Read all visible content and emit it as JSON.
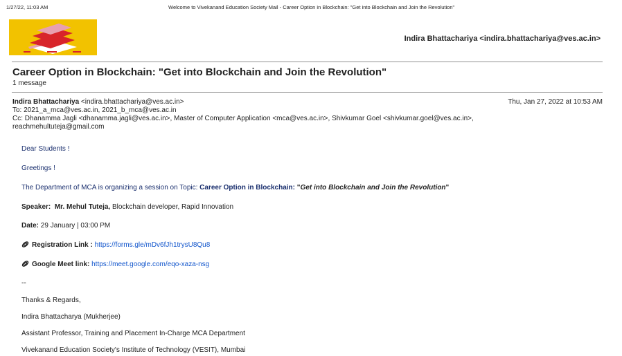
{
  "print_header": {
    "datetime": "1/27/22, 11:03 AM",
    "page_title": "Welcome to Vivekanand Education Society Mail - Career Option in Blockchain: \"Get into Blockchain and Join the Revolution\""
  },
  "account": {
    "user": "Indira Bhattachariya <indira.bhattachariya@ves.ac.in>",
    "logo_colors": {
      "background": "#f2c200",
      "red": "#d8242a",
      "pink": "#e8a0b0",
      "white": "#ffffff"
    }
  },
  "thread": {
    "subject": "Career Option in Blockchain: \"Get into Blockchain and Join the Revolution\"",
    "count": "1 message"
  },
  "message": {
    "from_name": "Indira Bhattachariya",
    "from_email": " <indira.bhattachariya@ves.ac.in>",
    "date": "Thu, Jan 27, 2022 at 10:53 AM",
    "to": "To: 2021_a_mca@ves.ac.in, 2021_b_mca@ves.ac.in",
    "cc": "Cc: Dhanamma Jagli <dhanamma.jagli@ves.ac.in>, Master of Computer Application <mca@ves.ac.in>, Shivkumar Goel <shivkumar.goel@ves.ac.in>,",
    "cc2": "reachmehultuteja@gmail.com"
  },
  "body": {
    "greeting": "Dear Students !",
    "greetings": "Greetings !",
    "intro": "The Department of MCA is organizing a session on Topic: ",
    "topic_label": "Career Option in Blockchain:",
    "topic_open_quote": " \"",
    "topic_title": "Get into Blockchain and Join the Revolution",
    "topic_close_quote": "\"",
    "speaker_label": "Speaker:",
    "speaker_name": "Mr. Mehul Tuteja,",
    "speaker_desc": " Blockchain developer, Rapid Innovation",
    "date_label": "Date:",
    "date_value": " 29 January | 03:00 PM",
    "reg_label": "Registration Link :",
    "reg_url": "https://forms.gle/mDv6fJh1trysU8Qu8",
    "meet_label": "Google Meet link:",
    "meet_url": "https://meet.google.com/eqo-xaza-nsg",
    "sig_sep": "--",
    "sig_regards": "Thanks & Regards,",
    "sig_name": "Indira Bhattacharya (Mukherjee)",
    "sig_title": "Assistant Professor, Training and Placement In-Charge MCA Department",
    "sig_org": "Vivekanand Education Society's Institute of Technology (VESIT), Mumbai"
  },
  "icons": {
    "link_icon": "paperclip-icon",
    "logo": "books-logo"
  }
}
